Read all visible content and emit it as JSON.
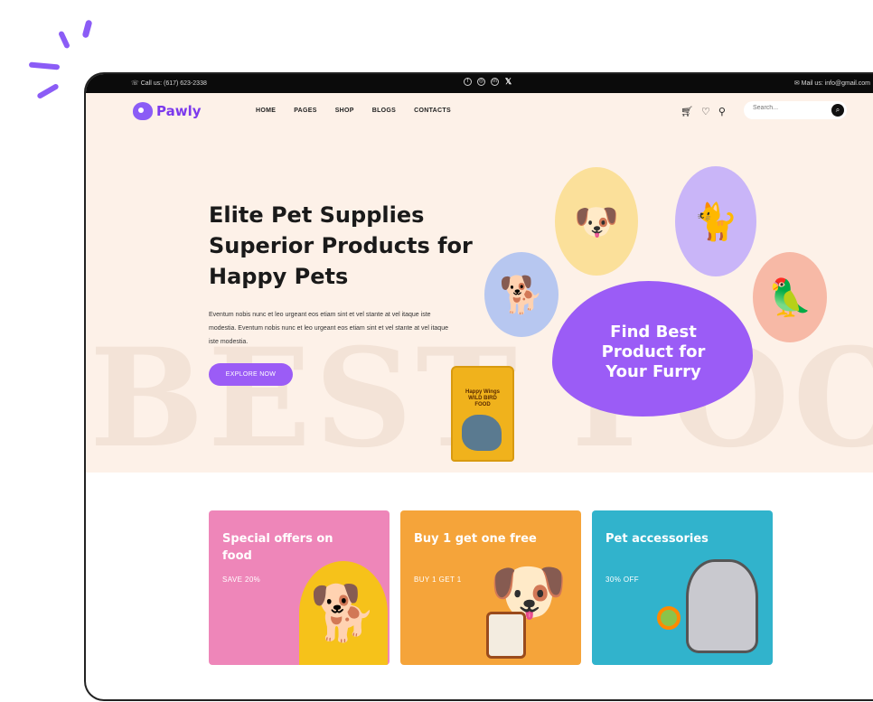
{
  "topbar": {
    "phone": "Call us: (617) 623-2338",
    "email": "Mail us: info@gmail.com",
    "social_icons": [
      "facebook-icon",
      "instagram-icon",
      "linkedin-icon",
      "x-icon"
    ]
  },
  "nav": {
    "logo": "Pawly",
    "menu": [
      "HOME",
      "PAGES",
      "SHOP",
      "BLOGS",
      "CONTACTS"
    ],
    "search_placeholder": "Search..."
  },
  "hero": {
    "headline_1": "Elite Pet Supplies",
    "headline_2": "Superior Products for",
    "headline_3": "Happy Pets",
    "paragraph": "Eventum nobis nunc et leo urgeant eos etiam sint et vel stante at vel itaque iste modestia. Eventum nobis nunc et leo urgeant eos etiam sint et vel stante at vel itaque iste modestia.",
    "cta": "EXPLORE NOW",
    "background_word": "BEST FOOD",
    "paw_text": "Find Best Product for Your Furry",
    "product_label_1": "Happy Wings",
    "product_label_2": "WILD BIRD FOOD"
  },
  "cards": [
    {
      "title": "Special offers on food",
      "subtitle": "SAVE 20%",
      "color": "#ee86b9"
    },
    {
      "title": "Buy 1 get one free",
      "subtitle": "BUY 1 GET 1",
      "color": "#f5a43a"
    },
    {
      "title": "Pet accessories",
      "subtitle": "30% OFF",
      "color": "#31b3cc"
    }
  ],
  "colors": {
    "accent": "#9b5cf6",
    "hero_bg": "#fdf1e8"
  }
}
